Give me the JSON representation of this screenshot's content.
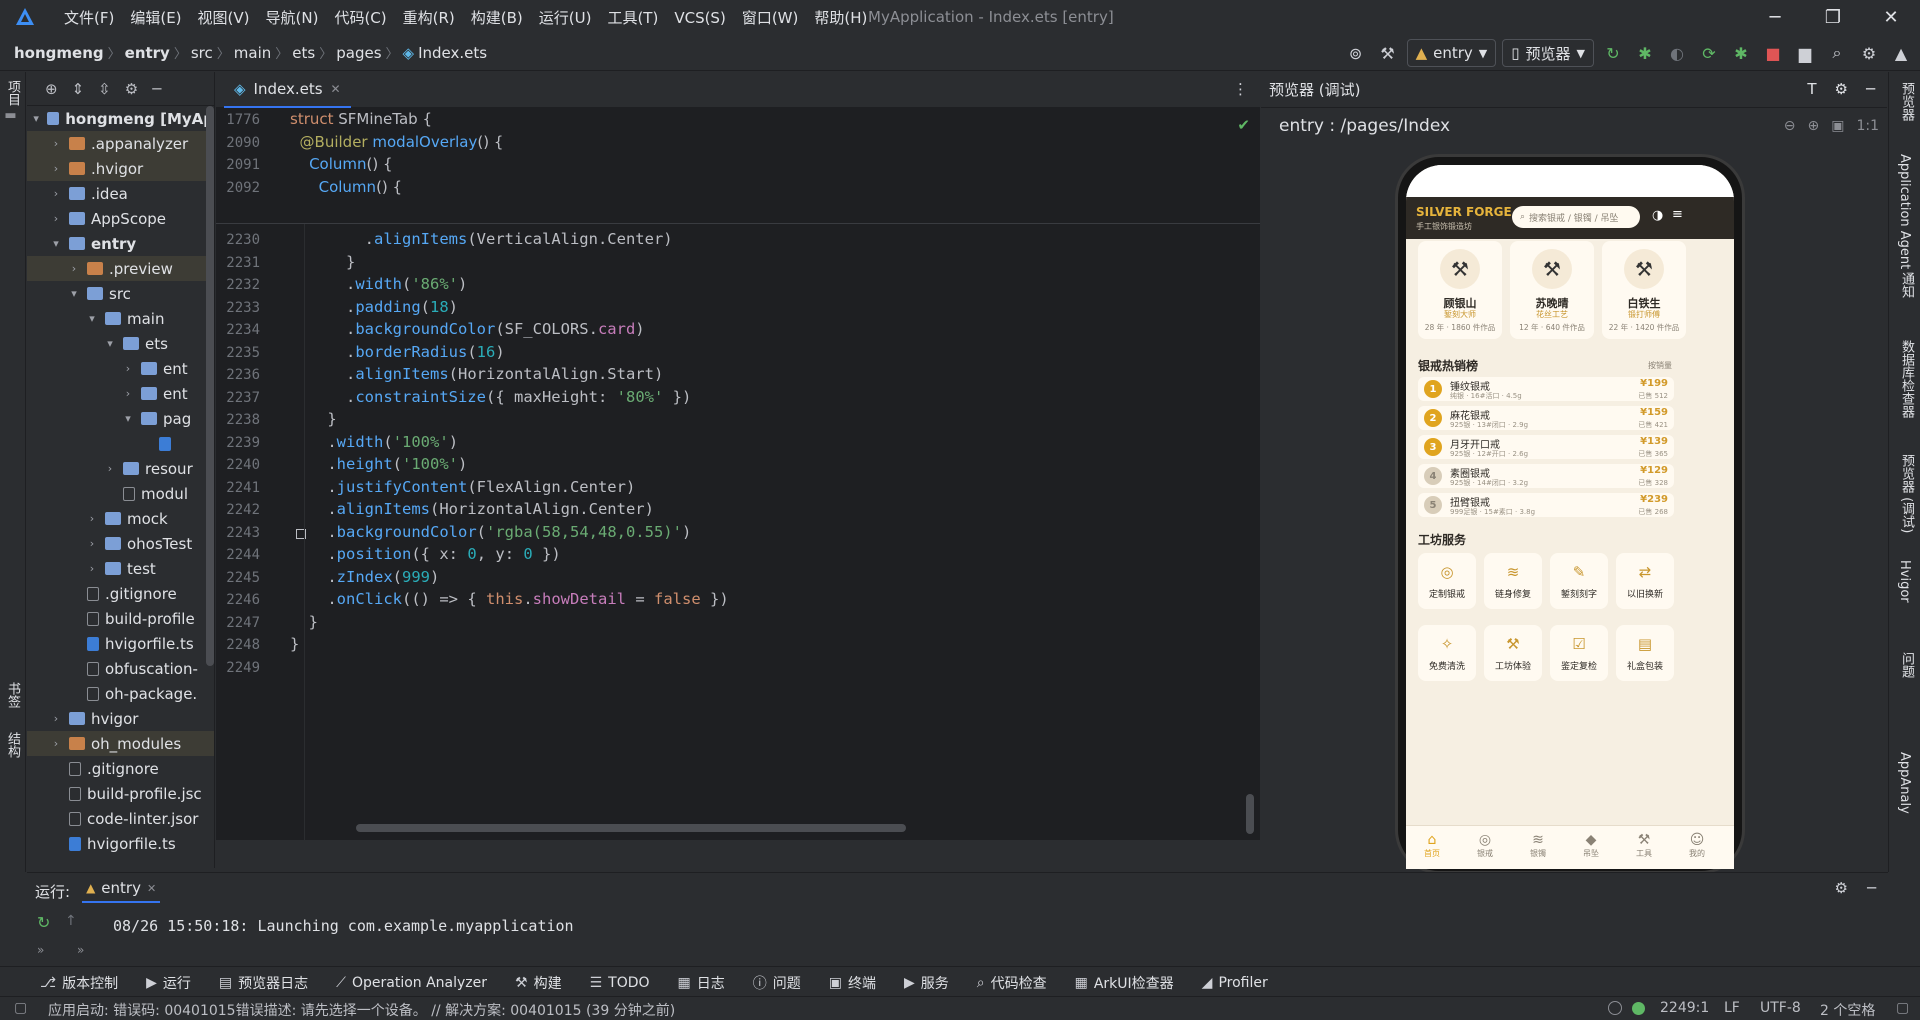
{
  "menubar": {
    "items": [
      "文件(F)",
      "编辑(E)",
      "视图(V)",
      "导航(N)",
      "代码(C)",
      "重构(R)",
      "构建(B)",
      "运行(U)",
      "工具(T)",
      "VCS(S)",
      "窗口(W)",
      "帮助(H)"
    ],
    "window_title": "MyApplication - Index.ets [entry]"
  },
  "breadcrumb": [
    "hongmeng",
    "entry",
    "src",
    "main",
    "ets",
    "pages",
    "Index.ets"
  ],
  "toolbar": {
    "run_config": "entry",
    "device": "预览器"
  },
  "left_strip": {
    "project": "项目",
    "bookmarks": "书签",
    "structure": "结构"
  },
  "project_tree": [
    {
      "label": "hongmeng [MyAp",
      "depth": 0,
      "arrow": "v",
      "icon": "blue",
      "bold": true
    },
    {
      "label": ".appanalyzer",
      "depth": 1,
      "arrow": ">",
      "icon": "orange",
      "hl": true
    },
    {
      "label": ".hvigor",
      "depth": 1,
      "arrow": ">",
      "icon": "orange",
      "hl": true
    },
    {
      "label": ".idea",
      "depth": 1,
      "arrow": ">",
      "icon": "blue"
    },
    {
      "label": "AppScope",
      "depth": 1,
      "arrow": ">",
      "icon": "blue"
    },
    {
      "label": "entry",
      "depth": 1,
      "arrow": "v",
      "icon": "blue",
      "bold": true
    },
    {
      "label": ".preview",
      "depth": 2,
      "arrow": ">",
      "icon": "orange",
      "hl": true
    },
    {
      "label": "src",
      "depth": 2,
      "arrow": "v",
      "icon": "blue"
    },
    {
      "label": "main",
      "depth": 3,
      "arrow": "v",
      "icon": "blue"
    },
    {
      "label": "ets",
      "depth": 4,
      "arrow": "v",
      "icon": "blue"
    },
    {
      "label": "ent",
      "depth": 5,
      "arrow": ">",
      "icon": "blue"
    },
    {
      "label": "ent",
      "depth": 5,
      "arrow": ">",
      "icon": "blue"
    },
    {
      "label": "pag",
      "depth": 5,
      "arrow": "v",
      "icon": "blue"
    },
    {
      "label": "",
      "depth": 6,
      "arrow": "",
      "icon": "ts"
    },
    {
      "label": "resour",
      "depth": 4,
      "arrow": ">",
      "icon": "blue"
    },
    {
      "label": "modul",
      "depth": 4,
      "arrow": "",
      "icon": "file"
    },
    {
      "label": "mock",
      "depth": 3,
      "arrow": ">",
      "icon": "blue"
    },
    {
      "label": "ohosTest",
      "depth": 3,
      "arrow": ">",
      "icon": "blue"
    },
    {
      "label": "test",
      "depth": 3,
      "arrow": ">",
      "icon": "blue"
    },
    {
      "label": ".gitignore",
      "depth": 2,
      "arrow": "",
      "icon": "file"
    },
    {
      "label": "build-profile",
      "depth": 2,
      "arrow": "",
      "icon": "file"
    },
    {
      "label": "hvigorfile.ts",
      "depth": 2,
      "arrow": "",
      "icon": "ts"
    },
    {
      "label": "obfuscation-",
      "depth": 2,
      "arrow": "",
      "icon": "file"
    },
    {
      "label": "oh-package.",
      "depth": 2,
      "arrow": "",
      "icon": "file"
    },
    {
      "label": "hvigor",
      "depth": 1,
      "arrow": ">",
      "icon": "blue"
    },
    {
      "label": "oh_modules",
      "depth": 1,
      "arrow": ">",
      "icon": "orange",
      "hl": true
    },
    {
      "label": ".gitignore",
      "depth": 1,
      "arrow": "",
      "icon": "file"
    },
    {
      "label": "build-profile.jsc",
      "depth": 1,
      "arrow": "",
      "icon": "file"
    },
    {
      "label": "code-linter.jsor",
      "depth": 1,
      "arrow": "",
      "icon": "file"
    },
    {
      "label": "hvigorfile.ts",
      "depth": 1,
      "arrow": "",
      "icon": "ts"
    }
  ],
  "editor": {
    "tab_label": "Index.ets",
    "sticky_lines": [
      {
        "n": "1776",
        "html": "<span class='kw'>struct</span> <span class='ty'>SFMineTab</span> {"
      },
      {
        "n": "2090",
        "html": "  <span class='an'>@Builder</span> <span class='fn'>modalOverlay</span>() {"
      },
      {
        "n": "2091",
        "html": "    <span class='fn'>Column</span>() {"
      },
      {
        "n": "2092",
        "html": "      <span class='fn'>Column</span>() {"
      }
    ],
    "lines": [
      {
        "n": "2230",
        "html": "        .<span class='fn'>alignItems</span>(VerticalAlign.Center)"
      },
      {
        "n": "2231",
        "html": "      }"
      },
      {
        "n": "2232",
        "html": "      .<span class='fn'>width</span>(<span class='st'>'86%'</span>)"
      },
      {
        "n": "2233",
        "html": "      .<span class='fn'>padding</span>(<span class='nm'>18</span>)"
      },
      {
        "n": "2234",
        "html": "      .<span class='fn'>backgroundColor</span>(SF_COLORS.<span class='pr'>card</span>)"
      },
      {
        "n": "2235",
        "html": "      .<span class='fn'>borderRadius</span>(<span class='nm'>16</span>)"
      },
      {
        "n": "2236",
        "html": "      .<span class='fn'>alignItems</span>(HorizontalAlign.Start)"
      },
      {
        "n": "2237",
        "html": "      .<span class='fn'>constraintSize</span>({ <span class='ty'>maxHeight</span>: <span class='st'>'80%'</span> })"
      },
      {
        "n": "2238",
        "html": "    }"
      },
      {
        "n": "2239",
        "html": "    .<span class='fn'>width</span>(<span class='st'>'100%'</span>)"
      },
      {
        "n": "2240",
        "html": "    .<span class='fn'>height</span>(<span class='st'>'100%'</span>)"
      },
      {
        "n": "2241",
        "html": "    .<span class='fn'>justifyContent</span>(FlexAlign.Center)"
      },
      {
        "n": "2242",
        "html": "    .<span class='fn'>alignItems</span>(HorizontalAlign.Center)"
      },
      {
        "n": "2243",
        "html": "    .<span class='fn'>backgroundColor</span>(<span class='st'>'rgba(58,54,48,0.55)'</span>)"
      },
      {
        "n": "2244",
        "html": "    .<span class='fn'>position</span>({ <span class='ty'>x</span>: <span class='nm'>0</span>, <span class='ty'>y</span>: <span class='nm'>0</span> })"
      },
      {
        "n": "2245",
        "html": "    .<span class='fn'>zIndex</span>(<span class='nm'>999</span>)"
      },
      {
        "n": "2246",
        "html": "    .<span class='fn'>onClick</span>(() => { <span class='kw'>this</span>.<span class='pr'>showDetail</span> = <span class='kw'>false</span> })"
      },
      {
        "n": "2247",
        "html": "  }"
      },
      {
        "n": "2248",
        "html": "}"
      },
      {
        "n": "2249",
        "html": ""
      }
    ]
  },
  "preview": {
    "header": "预览器 (调试)",
    "route": "entry : /pages/Index",
    "zoom_label": "1:1",
    "app": {
      "brand": "SILVER FORGE",
      "brand_sub": "手工银饰锻造坊",
      "search_placeholder": "搜索银戒 / 银镯 / 吊坠",
      "masters": [
        {
          "name": "顾银山",
          "title": "錾刻大师",
          "stat": "28 年 · 1860 件作品"
        },
        {
          "name": "苏晚晴",
          "title": "花丝工艺",
          "stat": "12 年 · 640 件作品"
        },
        {
          "name": "白铁生",
          "title": "锻打师傅",
          "stat": "22 年 · 1420 件作品"
        }
      ],
      "hot_title": "银戒热销榜",
      "hot_more": "按销量",
      "hot": [
        {
          "rank": "1",
          "name": "锤纹银戒",
          "desc": "纯银 · 16#活口 · 4.5g",
          "price": "¥199",
          "sold": "已售 512",
          "color": "#e0a41e"
        },
        {
          "rank": "2",
          "name": "麻花银戒",
          "desc": "925银 · 13#闭口 · 2.9g",
          "price": "¥159",
          "sold": "已售 421",
          "color": "#e0a41e"
        },
        {
          "rank": "3",
          "name": "月牙开口戒",
          "desc": "925银 · 12#开口 · 2.6g",
          "price": "¥139",
          "sold": "已售 365",
          "color": "#e0a41e"
        },
        {
          "rank": "4",
          "name": "素圈银戒",
          "desc": "925银 · 14#闭口 · 3.2g",
          "price": "¥129",
          "sold": "已售 328",
          "color": "#d8cdb9"
        },
        {
          "rank": "5",
          "name": "扭臂银戒",
          "desc": "999足银 · 15#素口 · 3.8g",
          "price": "¥239",
          "sold": "已售 268",
          "color": "#d8cdb9"
        }
      ],
      "service_title": "工坊服务",
      "services": [
        {
          "icon": "◎",
          "label": "定制银戒"
        },
        {
          "icon": "≋",
          "label": "链身修复"
        },
        {
          "icon": "✎",
          "label": "錾刻刻字"
        },
        {
          "icon": "⇄",
          "label": "以旧换新"
        },
        {
          "icon": "✧",
          "label": "免费清洗"
        },
        {
          "icon": "⚒",
          "label": "工坊体验"
        },
        {
          "icon": "☑",
          "label": "鉴定复检"
        },
        {
          "icon": "▤",
          "label": "礼盒包装"
        }
      ],
      "tabs": [
        {
          "icon": "⌂",
          "label": "首页"
        },
        {
          "icon": "◎",
          "label": "银戒"
        },
        {
          "icon": "≋",
          "label": "银镯"
        },
        {
          "icon": "◆",
          "label": "吊坠"
        },
        {
          "icon": "⚒",
          "label": "工具"
        },
        {
          "icon": "☺",
          "label": "我的"
        }
      ]
    }
  },
  "right_strip": [
    "预览器",
    "Application Agent",
    "通知",
    "数据库检查器",
    "预览器 (调试)",
    "Hvigor",
    "问题",
    "AppAnaly"
  ],
  "run_panel": {
    "label": "运行:",
    "tab": "entry",
    "log": "08/26 15:50:18: Launching com.example.myapplication"
  },
  "bottom_tools": [
    "版本控制",
    "运行",
    "预览器日志",
    "Operation Analyzer",
    "构建",
    "TODO",
    "日志",
    "问题",
    "终端",
    "服务",
    "代码检查",
    "ArkUI检查器",
    "Profiler"
  ],
  "status": {
    "message": "应用启动: 错误码: 00401015错误描述: 请先选择一个设备。 // 解决方案: 00401015 (39 分钟之前)",
    "position": "2249:1",
    "line_sep": "LF",
    "encoding": "UTF-8",
    "indent": "2 个空格"
  }
}
